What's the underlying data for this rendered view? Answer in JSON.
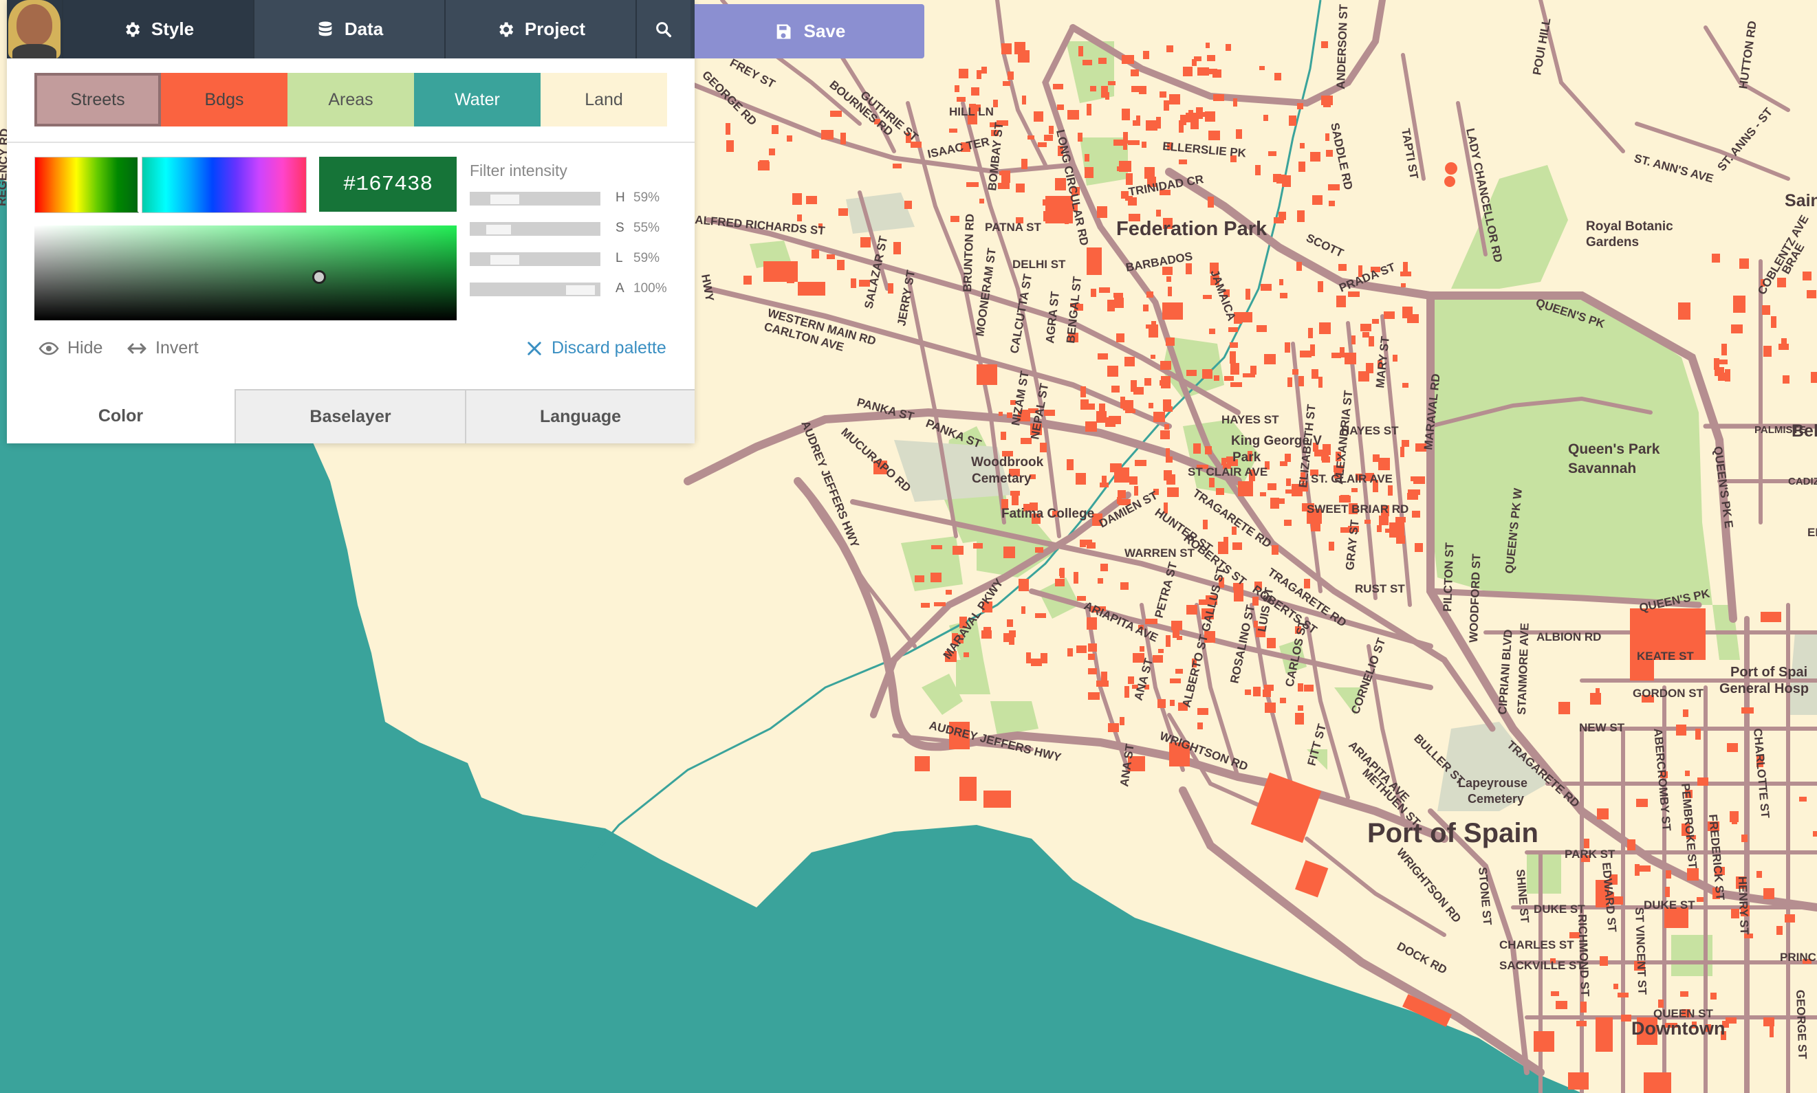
{
  "toolbar": {
    "style_label": "Style",
    "data_label": "Data",
    "project_label": "Project",
    "save_label": "Save"
  },
  "palette_categories": [
    {
      "label": "Streets",
      "color": "#c29c9c",
      "text_color": "#444444"
    },
    {
      "label": "Bdgs",
      "color": "#fa6340",
      "text_color": "#444444"
    },
    {
      "label": "Areas",
      "color": "#c7e2a1",
      "text_color": "#555555"
    },
    {
      "label": "Water",
      "color": "#3aa39b",
      "text_color": "#ffffff"
    },
    {
      "label": "Land",
      "color": "#fdf3d5",
      "text_color": "#555555"
    }
  ],
  "color_picker": {
    "hex": "#167438"
  },
  "filter": {
    "title": "Filter intensity",
    "rows": [
      {
        "letter": "H",
        "value": "59%"
      },
      {
        "letter": "S",
        "value": "55%"
      },
      {
        "letter": "L",
        "value": "59%"
      },
      {
        "letter": "A",
        "value": "100%"
      }
    ]
  },
  "actions": {
    "hide_label": "Hide",
    "invert_label": "Invert",
    "discard_label": "Discard palette"
  },
  "tabs": {
    "color": "Color",
    "baselayer": "Baselayer",
    "language": "Language"
  },
  "map": {
    "colors": {
      "water": "#3aa39b",
      "land": "#fdf3d5",
      "areas": "#c7e2a1",
      "buildings": "#fa6340",
      "streets": "#b58e90",
      "labels": "#4a3a3c",
      "river": "#3aa39b"
    },
    "place_labels": {
      "port_of_spain": "Port of Spain",
      "federation_park": "Federation Park",
      "downtown": "Downtown",
      "queens_park_savannah_1": "Queen's Park",
      "queens_park_savannah_2": "Savannah",
      "royal_botanic_1": "Royal Botanic",
      "royal_botanic_2": "Gardens",
      "king_george_1": "King George V",
      "king_george_2": "Park",
      "woodbrook_1": "Woodbrook",
      "woodbrook_2": "Cemetary",
      "fatima": "Fatima College",
      "lapeyrouse_1": "Lapeyrouse",
      "lapeyrouse_2": "Cemetery",
      "general_hosp_1": "Port of Spai",
      "general_hosp_2": "General Hosp",
      "belmont": "Belmo",
      "saint": "Sain",
      "cadiz": "CADIZ RD",
      "palmiste": "PALMISTE"
    },
    "street_labels": {
      "frey": "FREY ST",
      "george": "GEORGE RD",
      "bournes": "BOURNES RD",
      "guthrie": "GUTHRIE ST",
      "hill": "HILL LN",
      "isaac": "ISAAC TER",
      "bombay": "BOMBAY ST",
      "long_circular": "LONG CIRCULAR RD",
      "anderson": "ANDERSON ST",
      "saddle": "SADDLE RD",
      "tapti": "TAPTI ST",
      "lady_chancellor": "LADY CHANCELLOR RD",
      "poui": "POUI HILL",
      "hutton": "HUTTON RD",
      "st_anns": "ST. ANN'S AVE",
      "st_anns2": "ST. ANNS - ST",
      "ellerslie": "ELLERSLIE PK",
      "trinidad": "TRINIDAD CR",
      "patna": "PATNA ST",
      "alfred": "ALFRED RICHARDS ST",
      "salazar": "SALAZAR ST",
      "brunton": "BRUNTON RD",
      "jerry": "JERRY ST",
      "delhi": "DELHI ST",
      "mooneram": "MOONERAM ST",
      "calcutta": "CALCUTTA ST",
      "agra": "AGRA ST",
      "bengal": "BENGAL ST",
      "barbados": "BARBADOS",
      "jamaica": "JAMAICA",
      "scott": "SCOTT",
      "prada": "PRADA ST",
      "queens_pk": "QUEEN'S PK",
      "western_main": "WESTERN MAIN RD",
      "carlton": "CARLTON AVE",
      "panka1": "PANKA ST",
      "panka2": "PANKA ST",
      "nizam": "NIZAM ST",
      "nepal": "NEPAL ST",
      "hayes1": "HAYES ST",
      "hayes2": "HAYES ST",
      "elizabeth": "ELIZABETH ST",
      "alexandria": "ALEXANDRIA ST",
      "mary": "MARY ST",
      "maraval_rd": "MARAVAL RD",
      "st_clair1": "ST CLAIR AVE",
      "st_clair2": "ST. CLAIR AVE",
      "mucurapo": "MUCURAPO RD",
      "audrey1": "AUDREY JEFFERS HWY",
      "damien": "DAMIEN ST",
      "tragarete1": "TRAGARETE RD",
      "hunter": "HUNTER ST",
      "roberts1": "ROBERTS ST",
      "sweet_briar": "SWEET BRIAR RD",
      "gray": "GRAY ST",
      "warren": "WARREN ST",
      "rust": "RUST ST",
      "tragarete2": "TRAGARETE RD",
      "roberts2": "ROBERTS ST",
      "petra": "PETRA ST",
      "ariapita1": "ARIAPITA AVE",
      "gallus": "GALLUS ST",
      "maraval_pkwy": "MARAVAL PKWY",
      "rosalino": "ROSALINO ST",
      "luis": "LUIS ST",
      "carlos": "CARLOS ST",
      "ana": "ANA ST",
      "alberto": "ALBERTO ST",
      "cornelio": "CORNELIO ST",
      "pilcton": "PILCTON ST",
      "woodford": "WOODFORD ST",
      "queens_pk_w": "QUEEN'S PK W",
      "queens_pk_e": "QUEEN'S PK E",
      "cipriani": "CIPRIANI BLVD",
      "stanmore": "STANMORE AVE",
      "albion": "ALBION RD",
      "queens_pk2": "QUEEN'S PK",
      "keate": "KEATE ST",
      "gordon": "GORDON ST",
      "new": "NEW ST",
      "audrey2": "AUDREY JEFFERS HWY",
      "wrightson1": "WRIGHTSON RD",
      "ana2": "ANA ST",
      "fitt": "FITT ST",
      "ariapita2": "ARIAPITA AVE",
      "methuen": "METHUEN ST",
      "buller": "BULLER ST",
      "tragarete3": "TRAGARETE RD",
      "abercromby": "ABERCROMBY ST",
      "pembroke": "PEMBROKE ST",
      "frederick": "FREDERICK ST",
      "charlotte": "CHARLOTTE ST",
      "park": "PARK ST",
      "wrightson2": "WRIGHTSON RD",
      "stone": "STONE ST",
      "shine": "SHINE ST",
      "edward": "EDWARD ST",
      "duke1": "DUKE ST",
      "duke2": "DUKE ST",
      "richmond": "RICHMOND ST",
      "st_vincent": "ST VINCENT ST",
      "henry": "HENRY ST",
      "charles": "CHARLES ST",
      "sackville": "SACKVILLE ST",
      "prince": "PRINCE ST",
      "george2": "GEORGE ST",
      "queen": "QUEEN ST",
      "dock": "DOCK RD",
      "hwy": "HWY",
      "regency": "REGENCY RD",
      "coblentz": "COBLENTZ AVE",
      "braeme": "BRAE",
      "er": "ER"
    }
  }
}
